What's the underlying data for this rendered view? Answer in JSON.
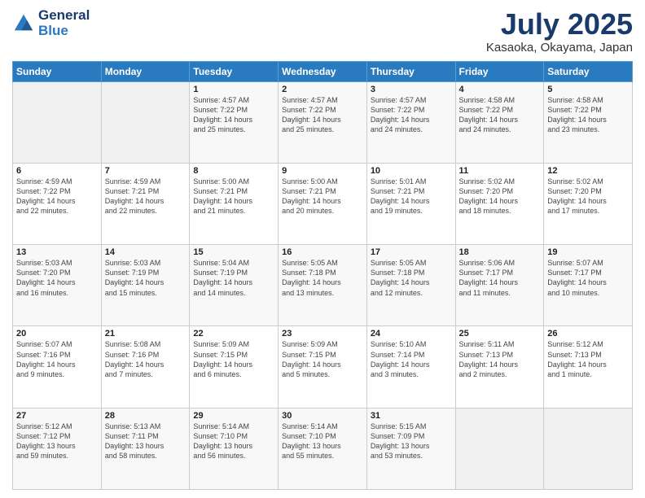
{
  "header": {
    "logo_line1": "General",
    "logo_line2": "Blue",
    "month": "July 2025",
    "location": "Kasaoka, Okayama, Japan"
  },
  "weekdays": [
    "Sunday",
    "Monday",
    "Tuesday",
    "Wednesday",
    "Thursday",
    "Friday",
    "Saturday"
  ],
  "weeks": [
    [
      {
        "day": "",
        "info": ""
      },
      {
        "day": "",
        "info": ""
      },
      {
        "day": "1",
        "info": "Sunrise: 4:57 AM\nSunset: 7:22 PM\nDaylight: 14 hours\nand 25 minutes."
      },
      {
        "day": "2",
        "info": "Sunrise: 4:57 AM\nSunset: 7:22 PM\nDaylight: 14 hours\nand 25 minutes."
      },
      {
        "day": "3",
        "info": "Sunrise: 4:57 AM\nSunset: 7:22 PM\nDaylight: 14 hours\nand 24 minutes."
      },
      {
        "day": "4",
        "info": "Sunrise: 4:58 AM\nSunset: 7:22 PM\nDaylight: 14 hours\nand 24 minutes."
      },
      {
        "day": "5",
        "info": "Sunrise: 4:58 AM\nSunset: 7:22 PM\nDaylight: 14 hours\nand 23 minutes."
      }
    ],
    [
      {
        "day": "6",
        "info": "Sunrise: 4:59 AM\nSunset: 7:22 PM\nDaylight: 14 hours\nand 22 minutes."
      },
      {
        "day": "7",
        "info": "Sunrise: 4:59 AM\nSunset: 7:21 PM\nDaylight: 14 hours\nand 22 minutes."
      },
      {
        "day": "8",
        "info": "Sunrise: 5:00 AM\nSunset: 7:21 PM\nDaylight: 14 hours\nand 21 minutes."
      },
      {
        "day": "9",
        "info": "Sunrise: 5:00 AM\nSunset: 7:21 PM\nDaylight: 14 hours\nand 20 minutes."
      },
      {
        "day": "10",
        "info": "Sunrise: 5:01 AM\nSunset: 7:21 PM\nDaylight: 14 hours\nand 19 minutes."
      },
      {
        "day": "11",
        "info": "Sunrise: 5:02 AM\nSunset: 7:20 PM\nDaylight: 14 hours\nand 18 minutes."
      },
      {
        "day": "12",
        "info": "Sunrise: 5:02 AM\nSunset: 7:20 PM\nDaylight: 14 hours\nand 17 minutes."
      }
    ],
    [
      {
        "day": "13",
        "info": "Sunrise: 5:03 AM\nSunset: 7:20 PM\nDaylight: 14 hours\nand 16 minutes."
      },
      {
        "day": "14",
        "info": "Sunrise: 5:03 AM\nSunset: 7:19 PM\nDaylight: 14 hours\nand 15 minutes."
      },
      {
        "day": "15",
        "info": "Sunrise: 5:04 AM\nSunset: 7:19 PM\nDaylight: 14 hours\nand 14 minutes."
      },
      {
        "day": "16",
        "info": "Sunrise: 5:05 AM\nSunset: 7:18 PM\nDaylight: 14 hours\nand 13 minutes."
      },
      {
        "day": "17",
        "info": "Sunrise: 5:05 AM\nSunset: 7:18 PM\nDaylight: 14 hours\nand 12 minutes."
      },
      {
        "day": "18",
        "info": "Sunrise: 5:06 AM\nSunset: 7:17 PM\nDaylight: 14 hours\nand 11 minutes."
      },
      {
        "day": "19",
        "info": "Sunrise: 5:07 AM\nSunset: 7:17 PM\nDaylight: 14 hours\nand 10 minutes."
      }
    ],
    [
      {
        "day": "20",
        "info": "Sunrise: 5:07 AM\nSunset: 7:16 PM\nDaylight: 14 hours\nand 9 minutes."
      },
      {
        "day": "21",
        "info": "Sunrise: 5:08 AM\nSunset: 7:16 PM\nDaylight: 14 hours\nand 7 minutes."
      },
      {
        "day": "22",
        "info": "Sunrise: 5:09 AM\nSunset: 7:15 PM\nDaylight: 14 hours\nand 6 minutes."
      },
      {
        "day": "23",
        "info": "Sunrise: 5:09 AM\nSunset: 7:15 PM\nDaylight: 14 hours\nand 5 minutes."
      },
      {
        "day": "24",
        "info": "Sunrise: 5:10 AM\nSunset: 7:14 PM\nDaylight: 14 hours\nand 3 minutes."
      },
      {
        "day": "25",
        "info": "Sunrise: 5:11 AM\nSunset: 7:13 PM\nDaylight: 14 hours\nand 2 minutes."
      },
      {
        "day": "26",
        "info": "Sunrise: 5:12 AM\nSunset: 7:13 PM\nDaylight: 14 hours\nand 1 minute."
      }
    ],
    [
      {
        "day": "27",
        "info": "Sunrise: 5:12 AM\nSunset: 7:12 PM\nDaylight: 13 hours\nand 59 minutes."
      },
      {
        "day": "28",
        "info": "Sunrise: 5:13 AM\nSunset: 7:11 PM\nDaylight: 13 hours\nand 58 minutes."
      },
      {
        "day": "29",
        "info": "Sunrise: 5:14 AM\nSunset: 7:10 PM\nDaylight: 13 hours\nand 56 minutes."
      },
      {
        "day": "30",
        "info": "Sunrise: 5:14 AM\nSunset: 7:10 PM\nDaylight: 13 hours\nand 55 minutes."
      },
      {
        "day": "31",
        "info": "Sunrise: 5:15 AM\nSunset: 7:09 PM\nDaylight: 13 hours\nand 53 minutes."
      },
      {
        "day": "",
        "info": ""
      },
      {
        "day": "",
        "info": ""
      }
    ]
  ]
}
